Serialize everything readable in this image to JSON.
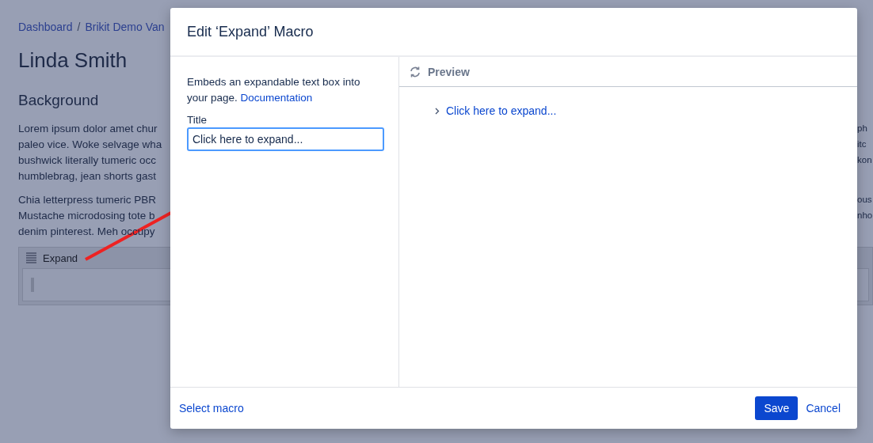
{
  "page": {
    "breadcrumb": [
      "Dashboard",
      "Brikit Demo Van"
    ],
    "breadcrumb_separator": "/",
    "title": "Linda Smith",
    "heading": "Background",
    "paragraphs": [
      {
        "lines": [
          {
            "left": "Lorem ipsum dolor amet chur",
            "right": "ph"
          },
          {
            "left": "paleo vice. Woke selvage wha",
            "right": "itc"
          },
          {
            "left": "bushwick literally tumeric occ",
            "right": "kon"
          },
          {
            "left": "humblebrag, jean shorts gast"
          }
        ]
      },
      {
        "lines": [
          {
            "left": "Chia letterpress tumeric PBR",
            "right": "ous"
          },
          {
            "left": "Mustache microdosing tote b",
            "right": "nho"
          },
          {
            "left": "denim pinterest. Meh occupy"
          }
        ]
      }
    ],
    "macro": {
      "label": "Expand"
    }
  },
  "dialog": {
    "title": "Edit ‘Expand’ Macro",
    "description": "Embeds an expandable text box into your page.",
    "doc_link": "Documentation",
    "field": {
      "label": "Title",
      "value": "Click here to expand..."
    },
    "preview": {
      "title": "Preview",
      "expand_text": "Click here to expand..."
    },
    "footer": {
      "select_link": "Select macro",
      "buttons": [
        {
          "kind": "primary",
          "label": "Save"
        },
        {
          "kind": "link",
          "label": "Cancel"
        }
      ]
    }
  }
}
